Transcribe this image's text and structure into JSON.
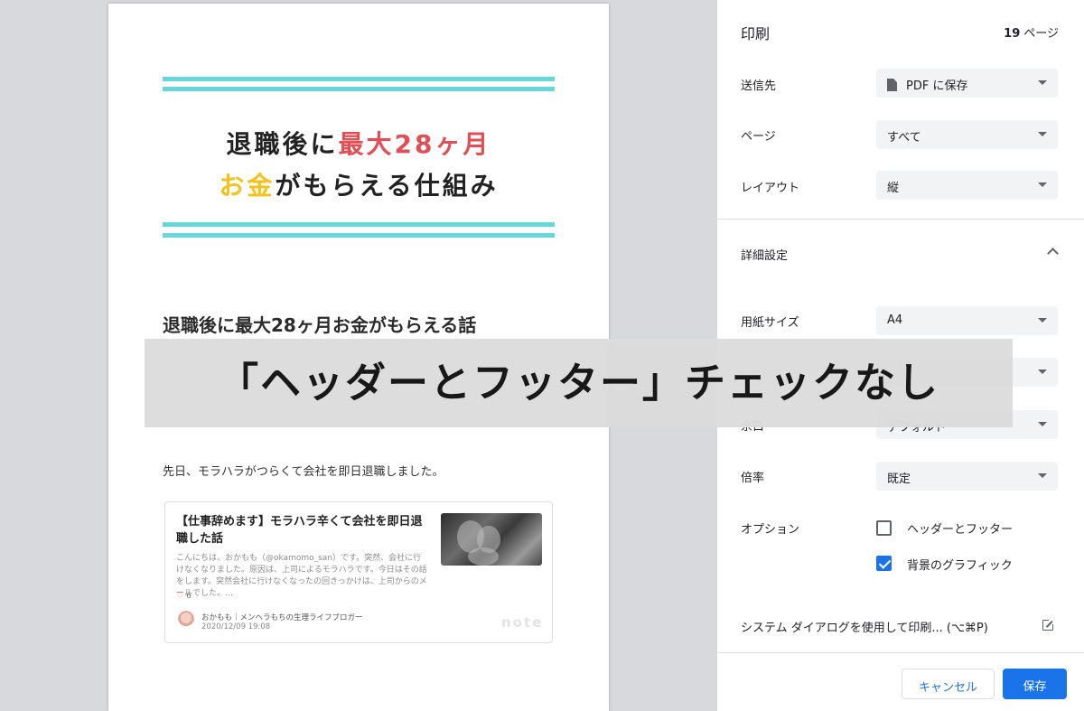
{
  "preview": {
    "hero_line1_black": "退職後に",
    "hero_line1_red": "最大28ヶ月",
    "hero_line2_yellow": "お金",
    "hero_line2_black": "がもらえる仕組み",
    "article_title": "退職後に最大28ヶ月お金がもらえる話",
    "body_text": "先日、モラハラがつらくて会社を即日退職しました。",
    "card": {
      "title": "【仕事辞めます】モラハラ辛くて会社を即日退職した話",
      "excerpt": "こんにちは、おかもも（@okamomo_san）です。突然、会社に行けなくなりました。原因は、上司によるモラハラです。今日はその話をします。突然会社に行けなくなったの回きっかけは、上司からのメールでした。…",
      "likes": "6",
      "author": "おかもも｜メンヘラもちの生理ライフブロガー",
      "date": "2020/12/09 19:08",
      "brand": "note"
    }
  },
  "panel": {
    "title": "印刷",
    "page_count_number": "19",
    "page_count_unit": "ページ",
    "destination_label": "送信先",
    "destination_value": "PDF に保存",
    "pages_label": "ページ",
    "pages_value": "すべて",
    "layout_label": "レイアウト",
    "layout_value": "縦",
    "more_settings_label": "詳細設定",
    "paper_size_label": "用紙サイズ",
    "paper_size_value": "A4",
    "margins_label": "余白",
    "margins_value": "デフォルト",
    "scale_label": "倍率",
    "scale_value": "既定",
    "options_label": "オプション",
    "option_headers_footers": "ヘッダーとフッター",
    "option_background_graphics": "背景のグラフィック",
    "system_dialog_link": "システム ダイアログを使用して印刷... (⌥⌘P)",
    "cancel_button": "キャンセル",
    "save_button": "保存"
  },
  "overlay": {
    "caption": "「ヘッダーとフッター」チェックなし"
  },
  "colors": {
    "stripe": "#67d7d9",
    "hero_red": "#e14f56",
    "hero_yellow": "#f3c21c",
    "accent_blue": "#1a73e8"
  },
  "options_state": {
    "headers_footers_checked": false,
    "background_graphics_checked": true
  }
}
